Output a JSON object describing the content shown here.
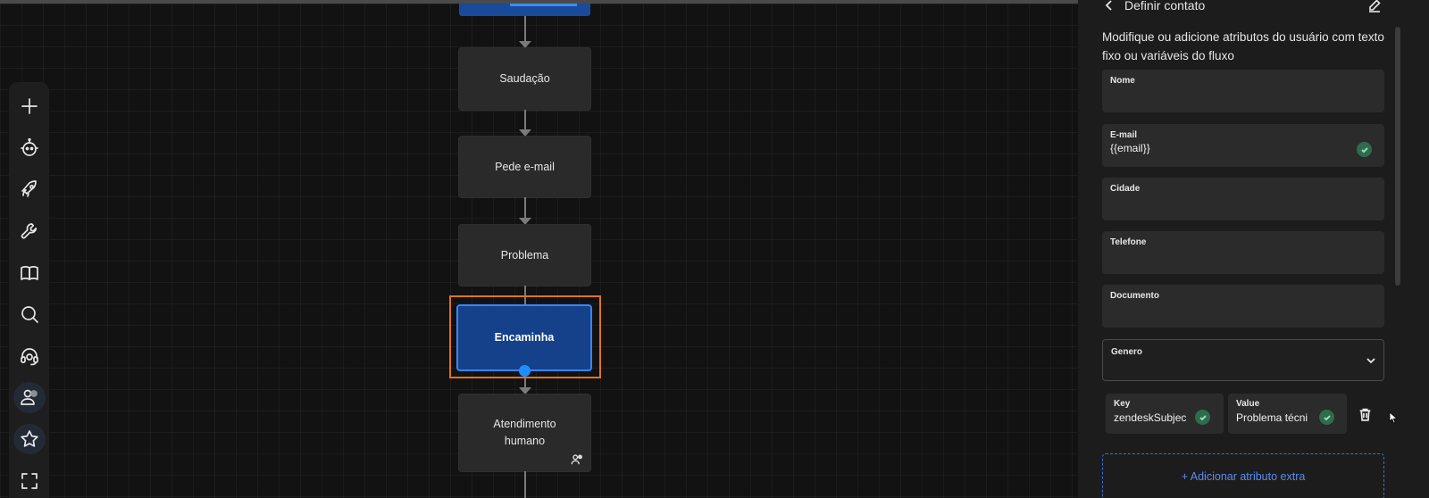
{
  "flow": {
    "nodes": [
      {
        "id": "saudacao",
        "label": "Saudação"
      },
      {
        "id": "pede-email",
        "label": "Pede e-mail"
      },
      {
        "id": "problema",
        "label": "Problema"
      },
      {
        "id": "encaminha",
        "label": "Encaminha"
      },
      {
        "id": "atendimento",
        "label": "Atendimento humano"
      }
    ]
  },
  "toolbar": {
    "icons": [
      "plus-icon",
      "bot-icon",
      "rocket-icon",
      "wrench-icon",
      "book-icon",
      "search-icon",
      "headset-icon",
      "users-icon",
      "star-icon",
      "fullscreen-icon"
    ]
  },
  "panel": {
    "title": "Definir contato",
    "description": "Modifique ou adicione atributos do usuário com texto fixo ou variáveis do fluxo",
    "fields": {
      "nome": {
        "label": "Nome",
        "value": ""
      },
      "email": {
        "label": "E-mail",
        "value": "{{email}}"
      },
      "cidade": {
        "label": "Cidade",
        "value": ""
      },
      "telefone": {
        "label": "Telefone",
        "value": ""
      },
      "documento": {
        "label": "Documento",
        "value": ""
      },
      "genero": {
        "label": "Genero",
        "value": ""
      }
    },
    "extra": {
      "key_label": "Key",
      "key_value": "zendeskSubjec",
      "value_label": "Value",
      "value_value": "Problema técni"
    },
    "add_extra_label": "+ Adicionar atributo extra"
  },
  "colors": {
    "selected_node": "#15418a",
    "selection_frame": "#e0741c",
    "accent_blue": "#3b84f0",
    "check_green": "#2f6b4f"
  }
}
